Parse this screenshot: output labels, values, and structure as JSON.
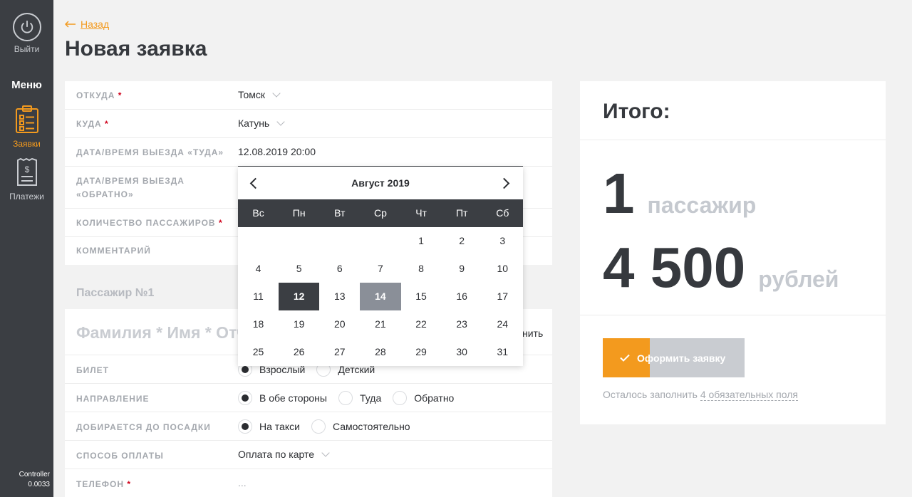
{
  "sidebar": {
    "logout_label": "Выйти",
    "menu_title": "Меню",
    "items": [
      {
        "label": "Заявки",
        "active": true,
        "icon": "clipboard-list-icon"
      },
      {
        "label": "Платежи",
        "active": false,
        "icon": "receipt-dollar-icon"
      }
    ],
    "footer_line1": "Controller",
    "footer_line2": "0.0033"
  },
  "header": {
    "back_label": "Назад",
    "title": "Новая заявка"
  },
  "form": {
    "from_label": "ОТКУДА",
    "from_value": "Томск",
    "to_label": "КУДА",
    "to_value": "Катунь",
    "depart_label": "ДАТА/ВРЕМЯ ВЫЕЗДА «ТУДА»",
    "depart_value": "12.08.2019 20:00",
    "return_label_1": "ДАТА/ВРЕМЯ ВЫЕЗДА",
    "return_label_2": "«ОБРАТНО»",
    "passengers_label": "КОЛИЧЕСТВО ПАССАЖИРОВ",
    "comment_label": "КОММЕНТАРИЙ"
  },
  "calendar": {
    "month_title": "Август 2019",
    "weekdays": [
      "Вс",
      "Пн",
      "Вт",
      "Ср",
      "Чт",
      "Пт",
      "Сб"
    ],
    "weeks": [
      [
        "",
        "",
        "",
        "",
        "1",
        "2",
        "3"
      ],
      [
        "4",
        "5",
        "6",
        "7",
        "8",
        "9",
        "10"
      ],
      [
        "11",
        "12",
        "13",
        "14",
        "15",
        "16",
        "17"
      ],
      [
        "18",
        "19",
        "20",
        "21",
        "22",
        "23",
        "24"
      ],
      [
        "25",
        "26",
        "27",
        "28",
        "29",
        "30",
        "31"
      ]
    ],
    "selected_day": "12",
    "today_day": "14",
    "selected_color": "#3b3e43",
    "today_color": "#8a8f98"
  },
  "passenger": {
    "section_title": "Пассажир №1",
    "name_placeholder": "Фамилия * Имя * Отчество",
    "right_action": "нить",
    "ticket_label": "БИЛЕТ",
    "ticket_options": [
      {
        "label": "Взрослый",
        "checked": true
      },
      {
        "label": "Детский",
        "checked": false
      }
    ],
    "direction_label": "НАПРАВЛЕНИЕ",
    "direction_options": [
      {
        "label": "В обе стороны",
        "checked": true
      },
      {
        "label": "Туда",
        "checked": false
      },
      {
        "label": "Обратно",
        "checked": false
      }
    ],
    "transfer_label": "ДОБИРАЕТСЯ ДО ПОСАДКИ",
    "transfer_options": [
      {
        "label": "На такси",
        "checked": true
      },
      {
        "label": "Самостоятельно",
        "checked": false
      }
    ],
    "payment_label": "СПОСОБ ОПЛАТЫ",
    "payment_value": "Оплата по карте",
    "phone_label": "ТЕЛЕФОН",
    "phone_value": "..."
  },
  "total": {
    "title": "Итого:",
    "passenger_count": "1",
    "passenger_unit": "пассажир",
    "price": "4 500",
    "price_unit": "рублей",
    "submit_label": "Оформить заявку",
    "submit_progress": 0.33,
    "remaining_prefix": "Осталось заполнить",
    "remaining_link": "4 обязательных поля"
  },
  "colors": {
    "accent": "#f39a1e",
    "sidebar_bg": "#3b3e43",
    "required": "#d0021b"
  }
}
